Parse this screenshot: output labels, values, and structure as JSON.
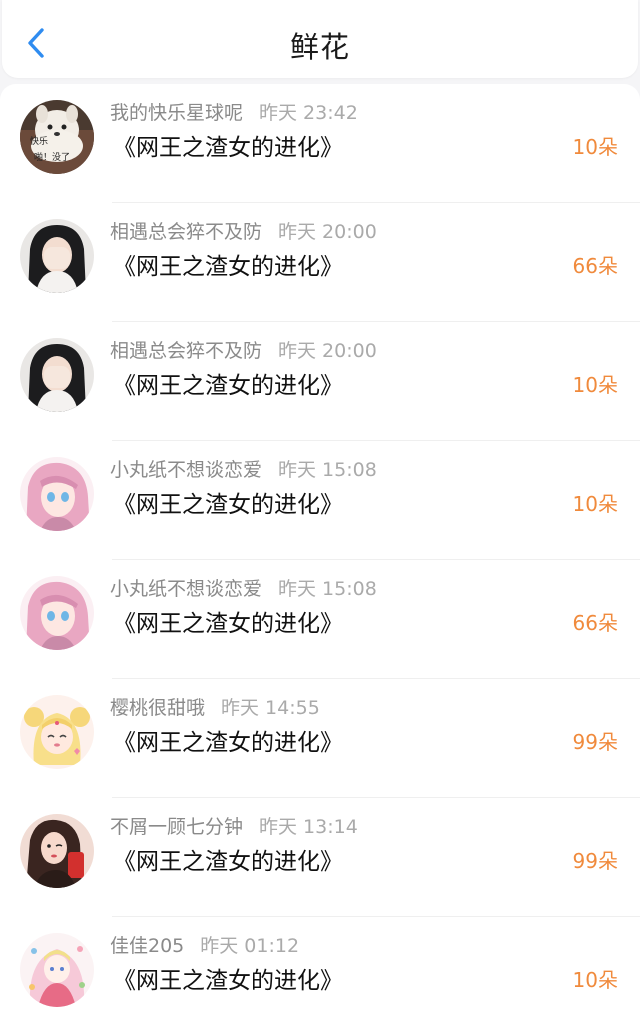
{
  "header": {
    "title": "鲜花"
  },
  "colors": {
    "accent": "#2f8cf0",
    "count": "#f08a3c",
    "meta": "#8a8a8a"
  },
  "list": [
    {
      "name": "我的快乐星球呢",
      "time": "昨天 23:42",
      "book": "《网王之渣女的进化》",
      "count": "10朵"
    },
    {
      "name": "相遇总会猝不及防",
      "time": "昨天 20:00",
      "book": "《网王之渣女的进化》",
      "count": "66朵"
    },
    {
      "name": "相遇总会猝不及防",
      "time": "昨天 20:00",
      "book": "《网王之渣女的进化》",
      "count": "10朵"
    },
    {
      "name": "小丸纸不想谈恋爱",
      "time": "昨天 15:08",
      "book": "《网王之渣女的进化》",
      "count": "10朵"
    },
    {
      "name": "小丸纸不想谈恋爱",
      "time": "昨天 15:08",
      "book": "《网王之渣女的进化》",
      "count": "66朵"
    },
    {
      "name": "樱桃很甜哦",
      "time": "昨天 14:55",
      "book": "《网王之渣女的进化》",
      "count": "99朵"
    },
    {
      "name": "不屑一顾七分钟",
      "time": "昨天 13:14",
      "book": "《网王之渣女的进化》",
      "count": "99朵"
    },
    {
      "name": "佳佳205",
      "time": "昨天 01:12",
      "book": "《网王之渣女的进化》",
      "count": "10朵"
    }
  ],
  "avatars": {
    "meme_text_1": "快乐",
    "meme_text_2": "啪！没了"
  }
}
